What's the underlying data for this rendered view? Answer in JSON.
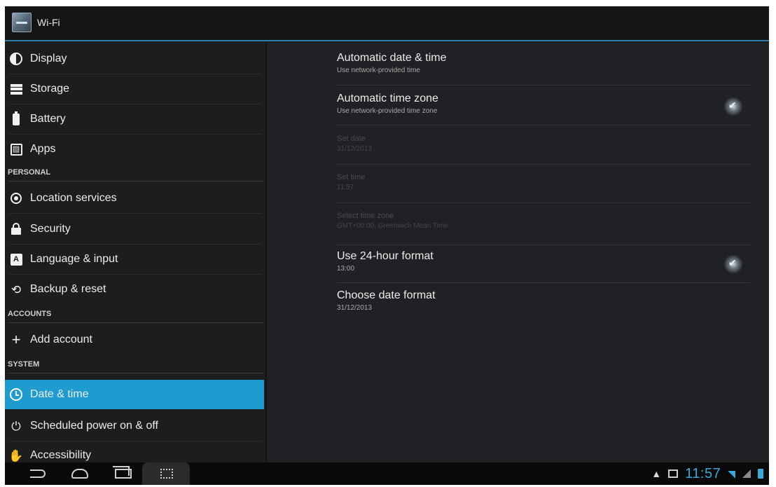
{
  "action_bar": {
    "title": "Wi-Fi"
  },
  "left_menu": {
    "items": [
      {
        "label": "Display",
        "icon": "display-icon"
      },
      {
        "label": "Storage",
        "icon": "storage-icon"
      },
      {
        "label": "Battery",
        "icon": "battery-icon"
      },
      {
        "label": "Apps",
        "icon": "apps-icon"
      }
    ],
    "sections": {
      "personal": "PERSONAL",
      "accounts": "ACCOUNTS",
      "system": "SYSTEM"
    },
    "personal_items": [
      {
        "label": "Location services",
        "icon": "location-icon"
      },
      {
        "label": "Security",
        "icon": "lock-icon"
      },
      {
        "label": "Language & input",
        "icon": "language-icon"
      },
      {
        "label": "Backup & reset",
        "icon": "backup-icon"
      }
    ],
    "accounts_items": [
      {
        "label": "Add account",
        "icon": "plus-icon"
      }
    ],
    "system_items": [
      {
        "label": "Date & time",
        "icon": "clock-icon",
        "selected": true
      },
      {
        "label": "Scheduled power on & off",
        "icon": "power-schedule-icon"
      },
      {
        "label": "Accessibility",
        "icon": "hand-icon"
      }
    ]
  },
  "date_time": {
    "auto_date": {
      "title": "Automatic date & time",
      "summary": "Use network-provided time"
    },
    "auto_zone": {
      "title": "Automatic time zone",
      "summary": "Use network-provided time zone",
      "checked": true
    },
    "set_date": {
      "title": "Set date",
      "summary": "31/12/2013"
    },
    "set_time": {
      "title": "Set time",
      "summary": "11:57"
    },
    "select_zone": {
      "title": "Select time zone",
      "summary": "GMT+00:00, Greenwich Mean Time"
    },
    "use_24h": {
      "title": "Use 24-hour format",
      "summary": "13:00",
      "checked": true
    },
    "date_format": {
      "title": "Choose date format",
      "summary": "31/12/2013"
    }
  },
  "status_bar": {
    "time": "11:57",
    "accent": "#3aa8d8"
  }
}
